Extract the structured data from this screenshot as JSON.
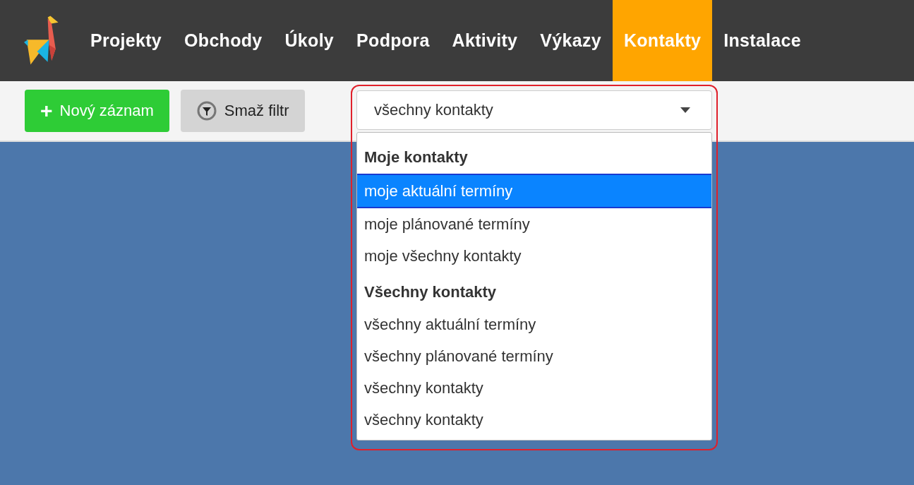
{
  "nav": [
    {
      "label": "Projekty",
      "selected": false
    },
    {
      "label": "Obchody",
      "selected": false
    },
    {
      "label": "Úkoly",
      "selected": false
    },
    {
      "label": "Podpora",
      "selected": false
    },
    {
      "label": "Aktivity",
      "selected": false
    },
    {
      "label": "Výkazy",
      "selected": false
    },
    {
      "label": "Kontakty",
      "selected": true
    },
    {
      "label": "Instalace",
      "selected": false
    }
  ],
  "toolbar": {
    "new_button": "Nový záznam",
    "plus": "+",
    "clear_button": "Smaž filtr"
  },
  "filter": {
    "value": "všechny kontakty",
    "expanded": true,
    "items": [
      {
        "kind": "header",
        "label": "Moje kontakty"
      },
      {
        "kind": "option",
        "label": "moje aktuální termíny",
        "highlighted": true
      },
      {
        "kind": "option",
        "label": "moje plánované termíny",
        "highlighted": false
      },
      {
        "kind": "option",
        "label": "moje všechny kontakty",
        "highlighted": false
      },
      {
        "kind": "header",
        "label": "Všechny kontakty"
      },
      {
        "kind": "option",
        "label": "všechny aktuální termíny",
        "highlighted": false
      },
      {
        "kind": "option",
        "label": "všechny plánované termíny",
        "highlighted": false
      },
      {
        "kind": "option",
        "label": "všechny kontakty",
        "highlighted": false
      },
      {
        "kind": "option",
        "label": "všechny kontakty",
        "highlighted": false
      }
    ]
  }
}
